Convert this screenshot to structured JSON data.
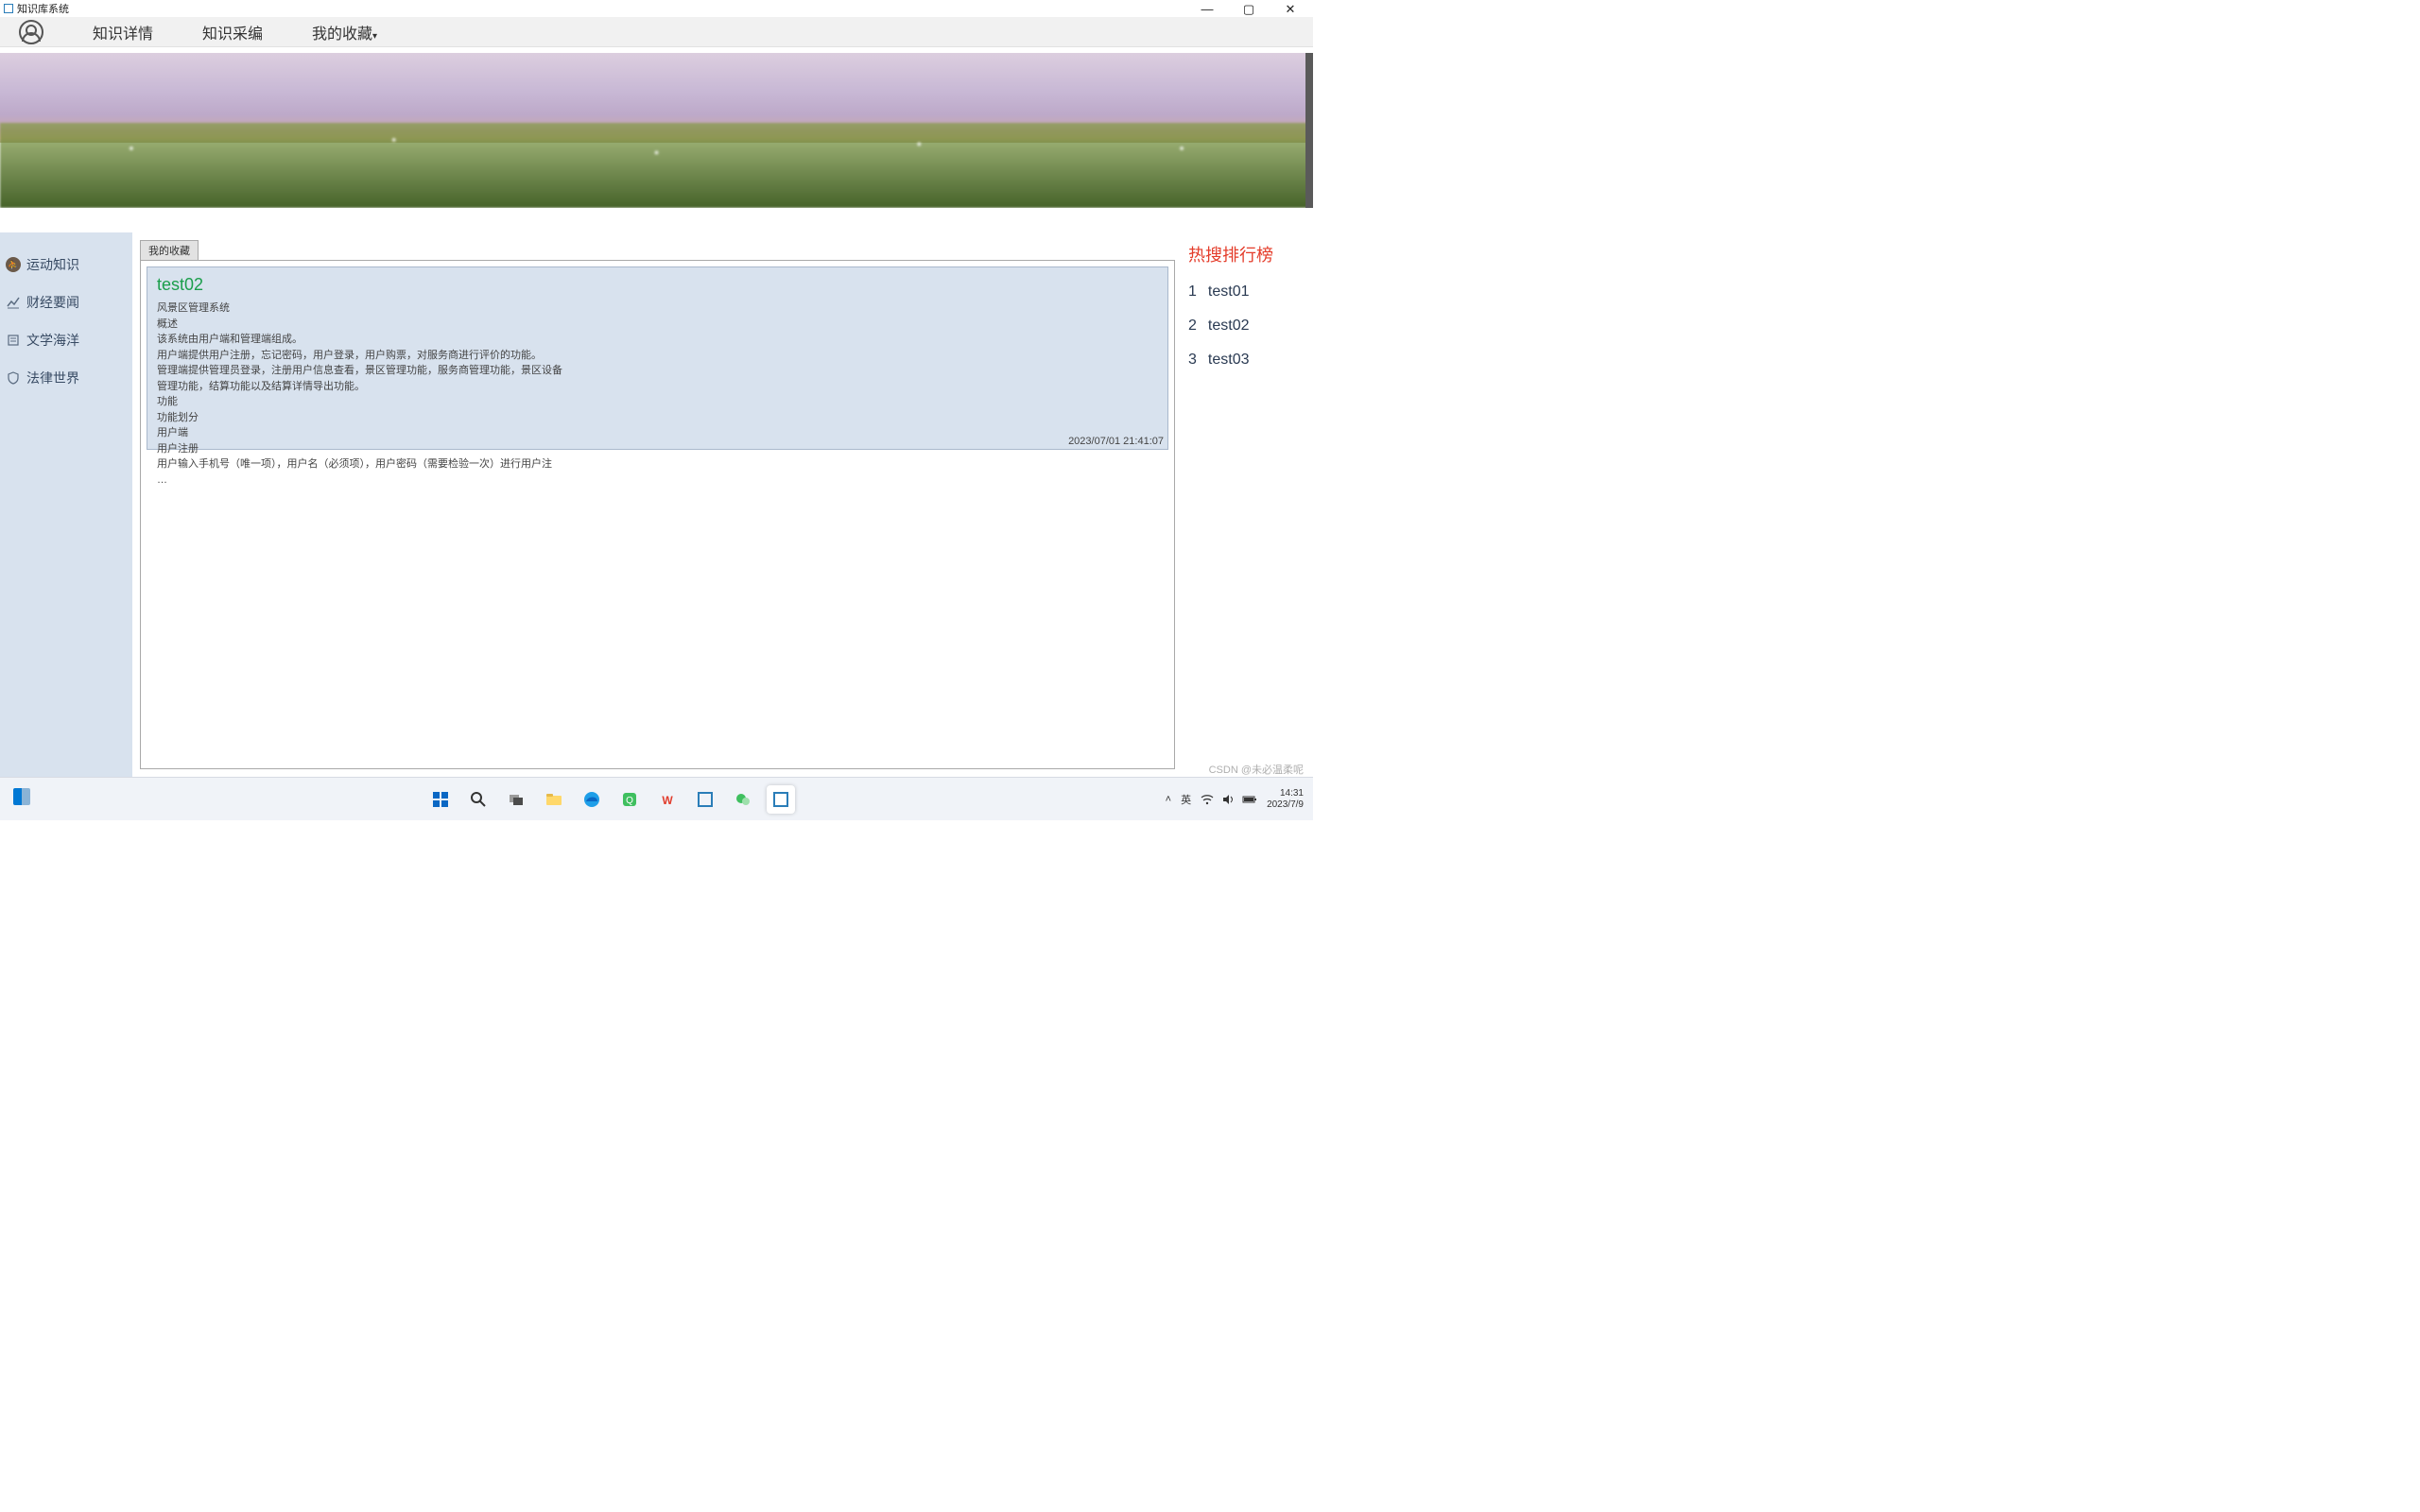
{
  "window": {
    "title": "知识库系统"
  },
  "nav": {
    "items": [
      {
        "label": "知识详情",
        "caret": false
      },
      {
        "label": "知识采编",
        "caret": false
      },
      {
        "label": "我的收藏",
        "caret": true
      }
    ]
  },
  "sidebar": {
    "items": [
      {
        "label": "运动知识",
        "icon": "sport"
      },
      {
        "label": "财经要闻",
        "icon": "chart"
      },
      {
        "label": "文学海洋",
        "icon": "book"
      },
      {
        "label": "法律世界",
        "icon": "shield"
      }
    ]
  },
  "tab": {
    "label": "我的收藏"
  },
  "article": {
    "title": "test02",
    "lines": [
      "风景区管理系统",
      "概述",
      "该系统由用户端和管理端组成。",
      "用户端提供用户注册，忘记密码，用户登录，用户购票，对服务商进行评价的功能。",
      "管理端提供管理员登录，注册用户信息查看，景区管理功能，服务商管理功能，景区设备",
      "管理功能，结算功能以及结算详情导出功能。",
      "功能",
      "功能划分",
      "用户端",
      "用户注册",
      "用户输入手机号（唯一项），用户名（必须项），用户密码（需要检验一次）进行用户注",
      "…"
    ],
    "time": "2023/07/01 21:41:07"
  },
  "rail": {
    "title": "热搜排行榜",
    "items": [
      {
        "rank": "1",
        "label": "test01"
      },
      {
        "rank": "2",
        "label": "test02"
      },
      {
        "rank": "3",
        "label": "test03"
      }
    ]
  },
  "taskbar": {
    "ime": "英",
    "time": "14:31",
    "date": "2023/7/9"
  },
  "watermark": "CSDN @未必温柔呢"
}
